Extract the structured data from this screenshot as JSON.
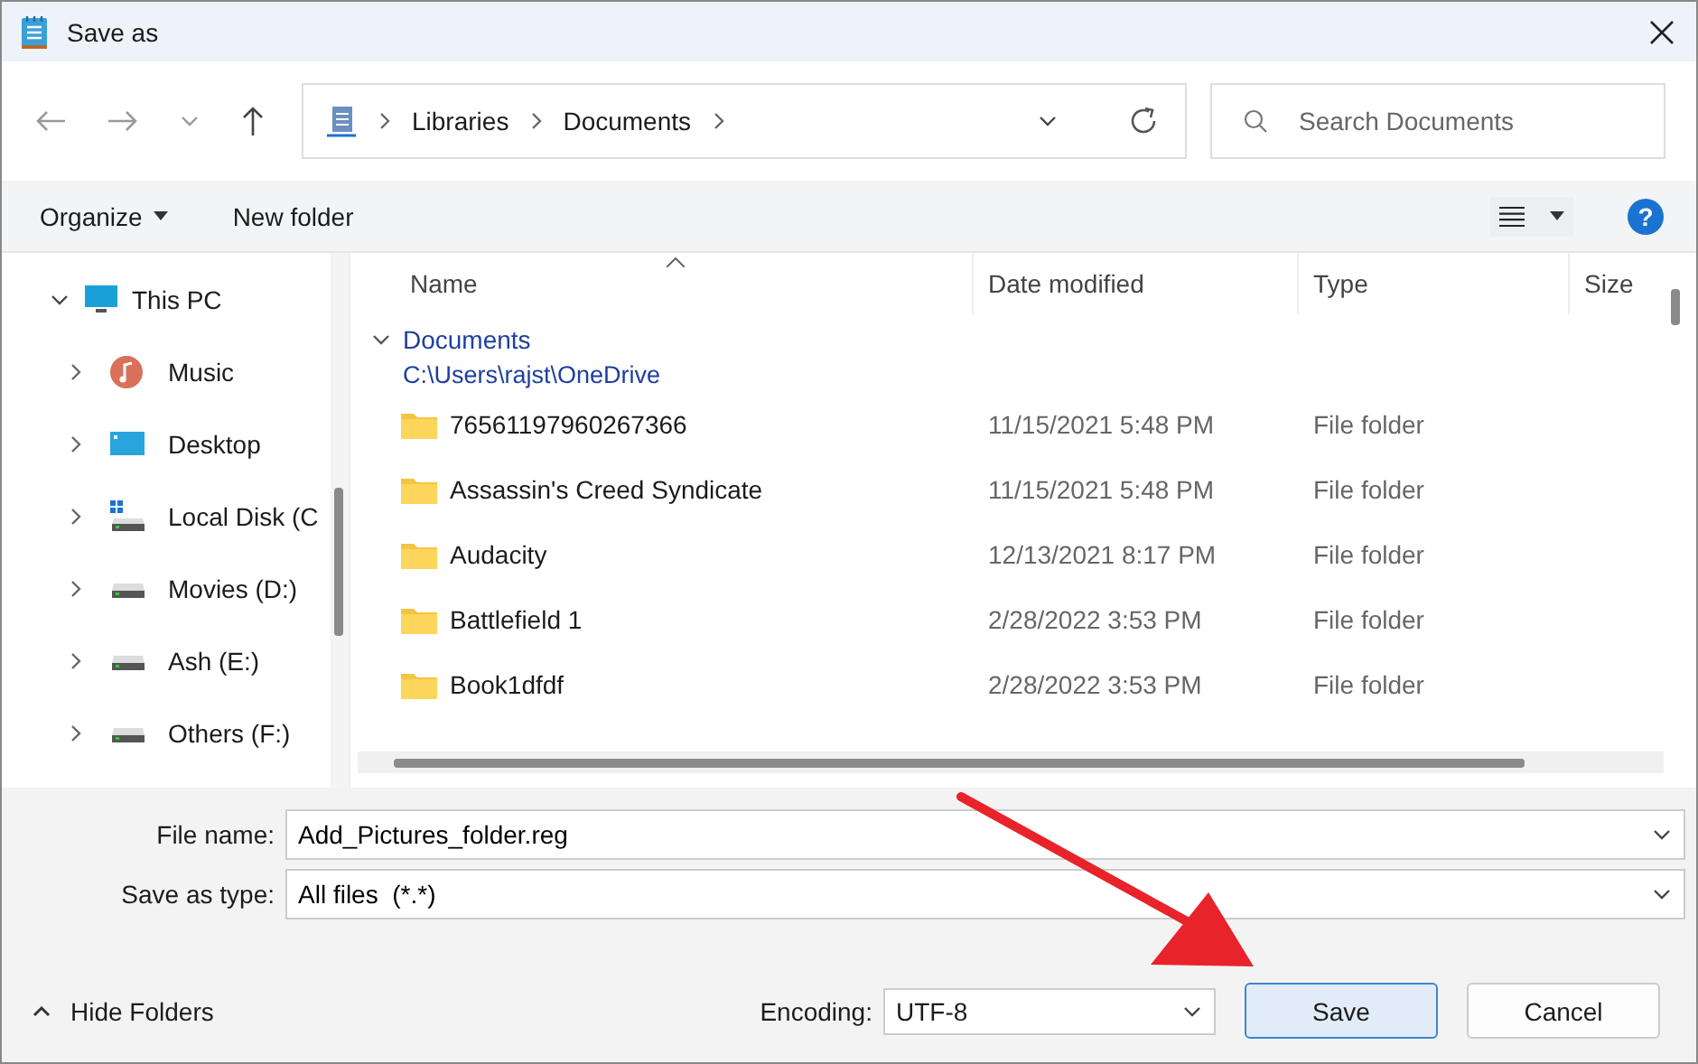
{
  "window": {
    "title": "Save as"
  },
  "breadcrumb": [
    "Libraries",
    "Documents"
  ],
  "search": {
    "placeholder": "Search Documents"
  },
  "toolbar": {
    "organize": "Organize",
    "new_folder": "New folder",
    "help": "?"
  },
  "sidebar": {
    "items": [
      {
        "label": "This PC",
        "kind": "pc",
        "expanded": true,
        "children": [
          {
            "label": "Music",
            "kind": "music",
            "expanded": false
          },
          {
            "label": "Desktop",
            "kind": "desktop",
            "expanded": false
          },
          {
            "label": "Local Disk (C",
            "kind": "system-drive",
            "expanded": false
          },
          {
            "label": "Movies (D:)",
            "kind": "drive",
            "expanded": false
          },
          {
            "label": "Ash (E:)",
            "kind": "drive",
            "expanded": false
          },
          {
            "label": "Others (F:)",
            "kind": "drive",
            "expanded": false
          }
        ]
      }
    ]
  },
  "table": {
    "columns": [
      "Name",
      "Date modified",
      "Type",
      "Size"
    ],
    "group": {
      "title": "Documents",
      "path": "C:\\Users\\rajst\\OneDrive",
      "expanded": true
    },
    "rows": [
      {
        "name": "76561197960267366",
        "date": "11/15/2021 5:48 PM",
        "type": "File folder"
      },
      {
        "name": "Assassin's Creed Syndicate",
        "date": "11/15/2021 5:48 PM",
        "type": "File folder"
      },
      {
        "name": "Audacity",
        "date": "12/13/2021 8:17 PM",
        "type": "File folder"
      },
      {
        "name": "Battlefield 1",
        "date": "2/28/2022 3:53 PM",
        "type": "File folder"
      },
      {
        "name": "Book1dfdf",
        "date": "2/28/2022 3:53 PM",
        "type": "File folder"
      }
    ]
  },
  "file_name": {
    "label": "File name:",
    "value": "Add_Pictures_folder.reg"
  },
  "save_type": {
    "label": "Save as type:",
    "value": "All files  (*.*)"
  },
  "footer": {
    "hide_folders": "Hide Folders",
    "encoding_label": "Encoding:",
    "encoding": "UTF-8",
    "buttons": [
      {
        "label": "Save",
        "kind": "primary"
      },
      {
        "label": "Cancel",
        "kind": "secondary"
      }
    ]
  }
}
